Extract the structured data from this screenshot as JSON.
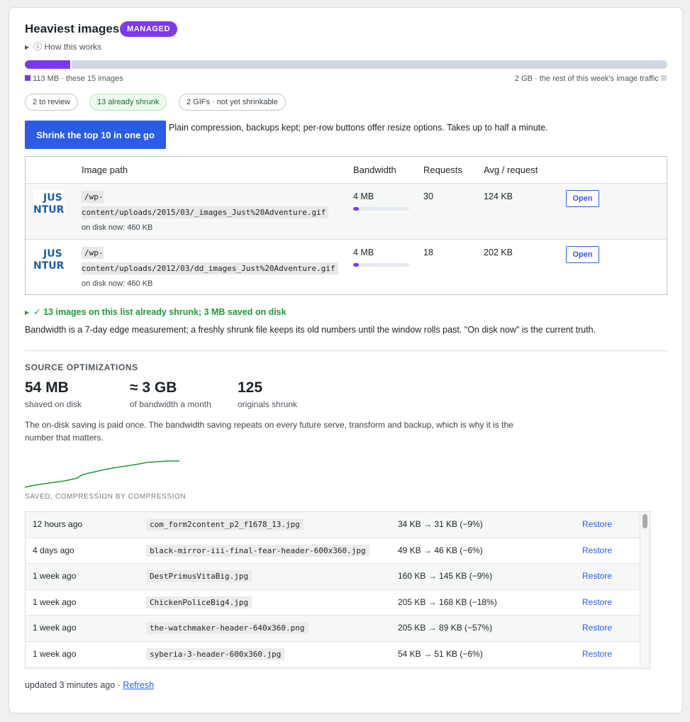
{
  "header": {
    "title": "Heaviest images",
    "badge": "MANAGED",
    "how_link": "ⓘ How this works"
  },
  "traffic": {
    "share_fraction": 0.055,
    "left_label": "113 MB · these 15 images",
    "right_label": "2 GB · the rest of this week's image traffic",
    "accent_color": "#7c3aed",
    "rest_color": "#d0d7e2"
  },
  "filters": [
    {
      "label": "2 to review"
    },
    {
      "label": "13 already shrunk"
    },
    {
      "label": "2 GIFs · not yet shrinkable"
    }
  ],
  "action": {
    "button_label": "Shrink the top 10 in one go",
    "description": "Plain compression, backups kept; per-row buttons offer resize options. Takes up to half a minute."
  },
  "table": {
    "columns": [
      "Image path",
      "Bandwidth",
      "Requests",
      "Avg / request"
    ],
    "rows": [
      {
        "path": "/wp-content/uploads/2015/03/_images_Just%20Adventure.gif",
        "disk": "on disk now: 460 KB",
        "bandwidth": "4 MB",
        "bandwidth_fraction": 0.1,
        "requests": "30",
        "avg": "124 KB",
        "action": "Open"
      },
      {
        "path": "/wp-content/uploads/2012/03/dd_images_Just%20Adventure.gif",
        "disk": "on disk now: 460 KB",
        "bandwidth": "4 MB",
        "bandwidth_fraction": 0.1,
        "requests": "18",
        "avg": "202 KB",
        "action": "Open"
      }
    ]
  },
  "shrunk_summary": "✓ 13 images on this list already shrunk; 3 MB saved on disk",
  "bandwidth_note": "Bandwidth is a 7-day edge measurement; a freshly shrunk file keeps its old numbers until the window rolls past. \"On disk now\" is the current truth.",
  "source": {
    "heading": "SOURCE OPTIMIZATIONS",
    "stats": [
      {
        "value": "54 MB",
        "label": "shaved on disk"
      },
      {
        "value": "≈ 3 GB",
        "label": "of bandwidth a month"
      },
      {
        "value": "125",
        "label": "originals shrunk"
      }
    ],
    "paragraph": "The on-disk saving is paid once. The bandwidth saving repeats on every future serve, transform and backup, which is why it is the number that matters.",
    "sparkline_label": "SAVED, COMPRESSION BY COMPRESSION",
    "sparkline_color": "#1e9a3a"
  },
  "history": [
    {
      "time": "12 hours ago",
      "file": "com_form2content_p2_f1678_13.jpg",
      "size": "34 KB → 31 KB (−9%)",
      "action": "Restore"
    },
    {
      "time": "4 days ago",
      "file": "black-mirror-iii-final-fear-header-600x360.jpg",
      "size": "49 KB → 46 KB (−6%)",
      "action": "Restore"
    },
    {
      "time": "1 week ago",
      "file": "DestPrimusVitaBig.jpg",
      "size": "160 KB → 145 KB (−9%)",
      "action": "Restore"
    },
    {
      "time": "1 week ago",
      "file": "ChickenPoliceBig4.jpg",
      "size": "205 KB → 168 KB (−18%)",
      "action": "Restore"
    },
    {
      "time": "1 week ago",
      "file": "the-watchmaker-header-640x360.png",
      "size": "205 KB → 89 KB (−57%)",
      "action": "Restore"
    },
    {
      "time": "1 week ago",
      "file": "syberia-3-header-600x360.jpg",
      "size": "54 KB → 51 KB (−6%)",
      "action": "Restore"
    }
  ],
  "footer": {
    "updated": "updated 3 minutes ago · ",
    "refresh": "Refresh"
  }
}
